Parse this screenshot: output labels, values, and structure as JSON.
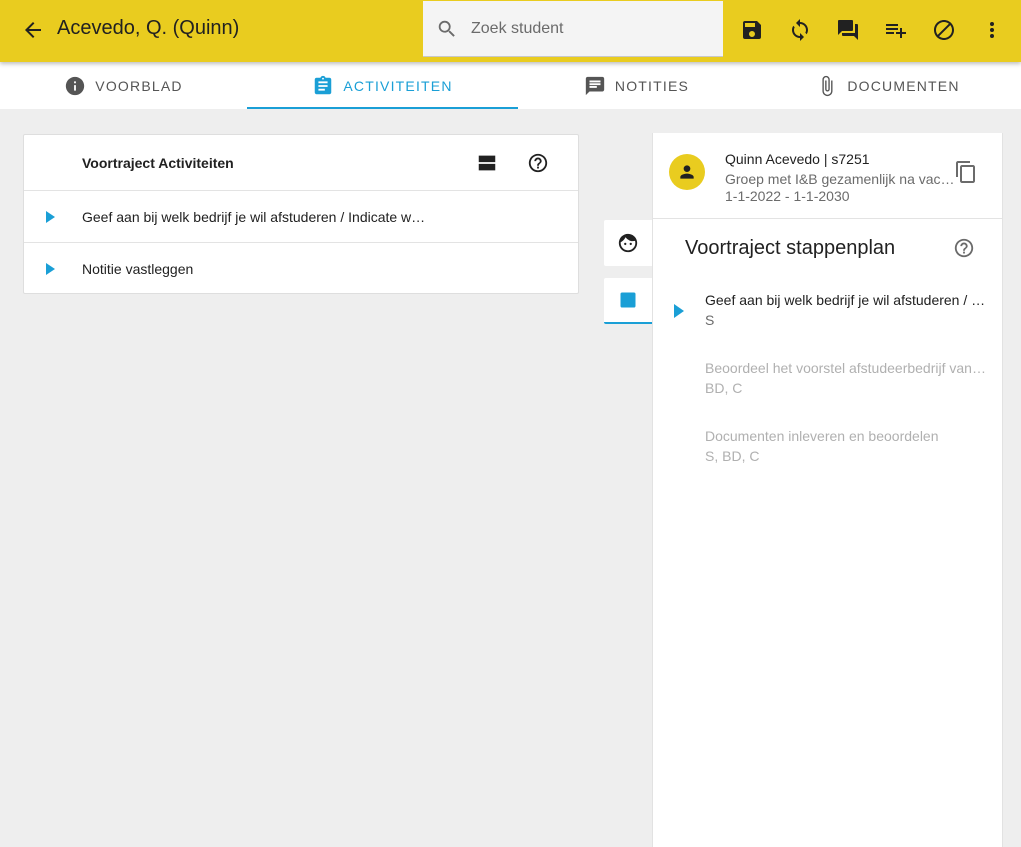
{
  "header": {
    "title": "Acevedo, Q. (Quinn)",
    "search_placeholder": "Zoek student",
    "icons": [
      "arrow-left-icon",
      "search-icon",
      "save-icon",
      "sync-icon",
      "chat-icon",
      "playlist-add-icon",
      "block-icon",
      "more-vert-icon"
    ],
    "accent_color": "#e9cc1f"
  },
  "tabs": [
    {
      "label": "VOORBLAD",
      "icon": "info-icon",
      "active": false
    },
    {
      "label": "ACTIVITEITEN",
      "icon": "clipboard-icon",
      "active": true
    },
    {
      "label": "NOTITIES",
      "icon": "notes-icon",
      "active": false
    },
    {
      "label": "DOCUMENTEN",
      "icon": "paperclip-icon",
      "active": false
    }
  ],
  "activities": {
    "title": "Voortraject Activiteiten",
    "items": [
      {
        "label": "Geef aan bij welk bedrijf je wil afstuderen / Indicate which company you want to graduate at"
      },
      {
        "label": "Notitie vastleggen"
      }
    ]
  },
  "student": {
    "name": "Quinn Acevedo | s7251",
    "group": "Groep met I&B gezamenlijk na vacature",
    "dates": "1-1-2022 - 1-1-2030"
  },
  "plan": {
    "title": "Voortraject stappenplan",
    "steps": [
      {
        "label": "Geef aan bij welk bedrijf je wil afstuderen / Indicate which company",
        "roles": "S",
        "active": true
      },
      {
        "label": "Beoordeel het voorstel afstudeerbedrijf van de student",
        "roles": "BD, C",
        "active": false
      },
      {
        "label": "Documenten inleveren en beoordelen",
        "roles": "S, BD, C",
        "active": false
      }
    ]
  },
  "colors": {
    "accent_blue": "#1a9fd6",
    "app_bar": "#e9cc1f"
  }
}
